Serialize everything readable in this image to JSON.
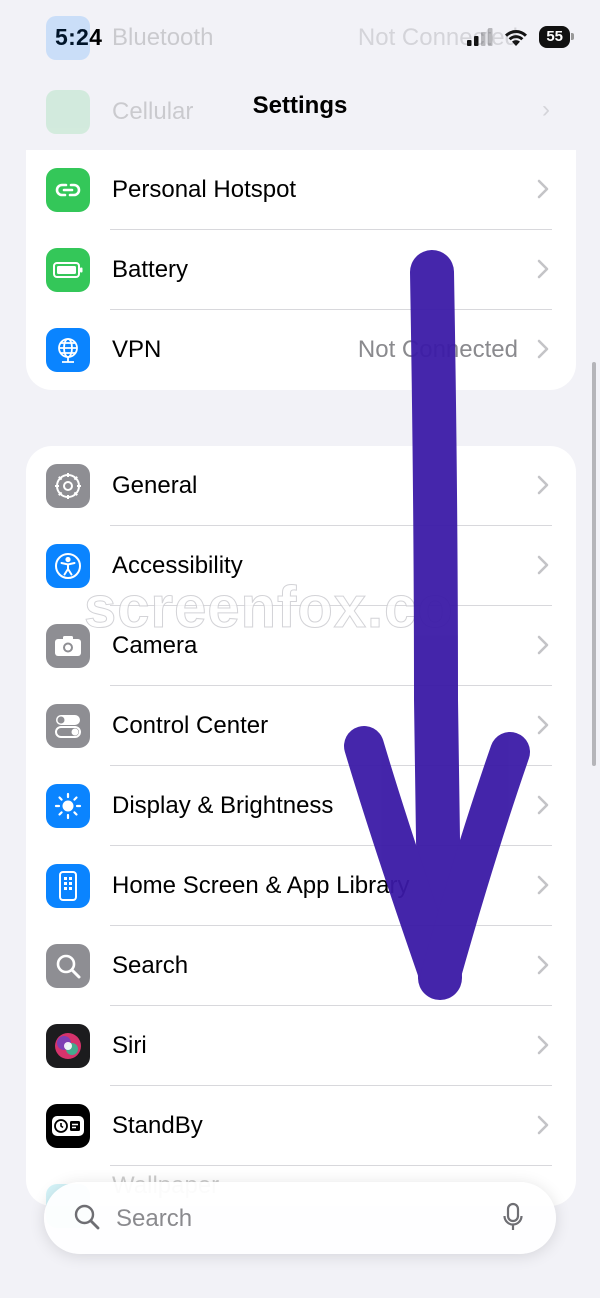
{
  "status_bar": {
    "time": "5:24",
    "battery": "55"
  },
  "nav": {
    "title": "Settings"
  },
  "faded_rows": [
    {
      "label": "Bluetooth",
      "value": "Not Connected",
      "icon": "bluetooth-icon",
      "color": "#007aff"
    },
    {
      "label": "Cellular",
      "value": "",
      "icon": "cellular-icon",
      "color": "#34c759"
    }
  ],
  "group1": [
    {
      "name": "personal-hotspot",
      "label": "Personal Hotspot",
      "value": "",
      "icon": "link-icon",
      "color": "#34c759"
    },
    {
      "name": "battery",
      "label": "Battery",
      "value": "",
      "icon": "battery-icon",
      "color": "#34c759"
    },
    {
      "name": "vpn",
      "label": "VPN",
      "value": "Not Connected",
      "icon": "globe-icon",
      "color": "#0a84ff"
    }
  ],
  "group2": [
    {
      "name": "general",
      "label": "General",
      "icon": "gear-icon",
      "color": "#8e8e93"
    },
    {
      "name": "accessibility",
      "label": "Accessibility",
      "icon": "accessibility-icon",
      "color": "#0a84ff"
    },
    {
      "name": "camera",
      "label": "Camera",
      "icon": "camera-icon",
      "color": "#8e8e93"
    },
    {
      "name": "control-center",
      "label": "Control Center",
      "icon": "toggles-icon",
      "color": "#8e8e93"
    },
    {
      "name": "display-brightness",
      "label": "Display & Brightness",
      "icon": "sun-icon",
      "color": "#0a84ff"
    },
    {
      "name": "home-screen",
      "label": "Home Screen & App Library",
      "icon": "phone-grid-icon",
      "color": "#0a84ff"
    },
    {
      "name": "search",
      "label": "Search",
      "icon": "magnifier-icon",
      "color": "#8e8e93"
    },
    {
      "name": "siri",
      "label": "Siri",
      "icon": "siri-icon",
      "color": "#1c1c1e"
    },
    {
      "name": "standby",
      "label": "StandBy",
      "icon": "standby-icon",
      "color": "#000000"
    }
  ],
  "under_search_label": "Wallpaper",
  "search_bar": {
    "placeholder": "Search"
  },
  "watermark": "screenfox.co",
  "annotation": {
    "arrow_color": "#3b1aa6"
  }
}
